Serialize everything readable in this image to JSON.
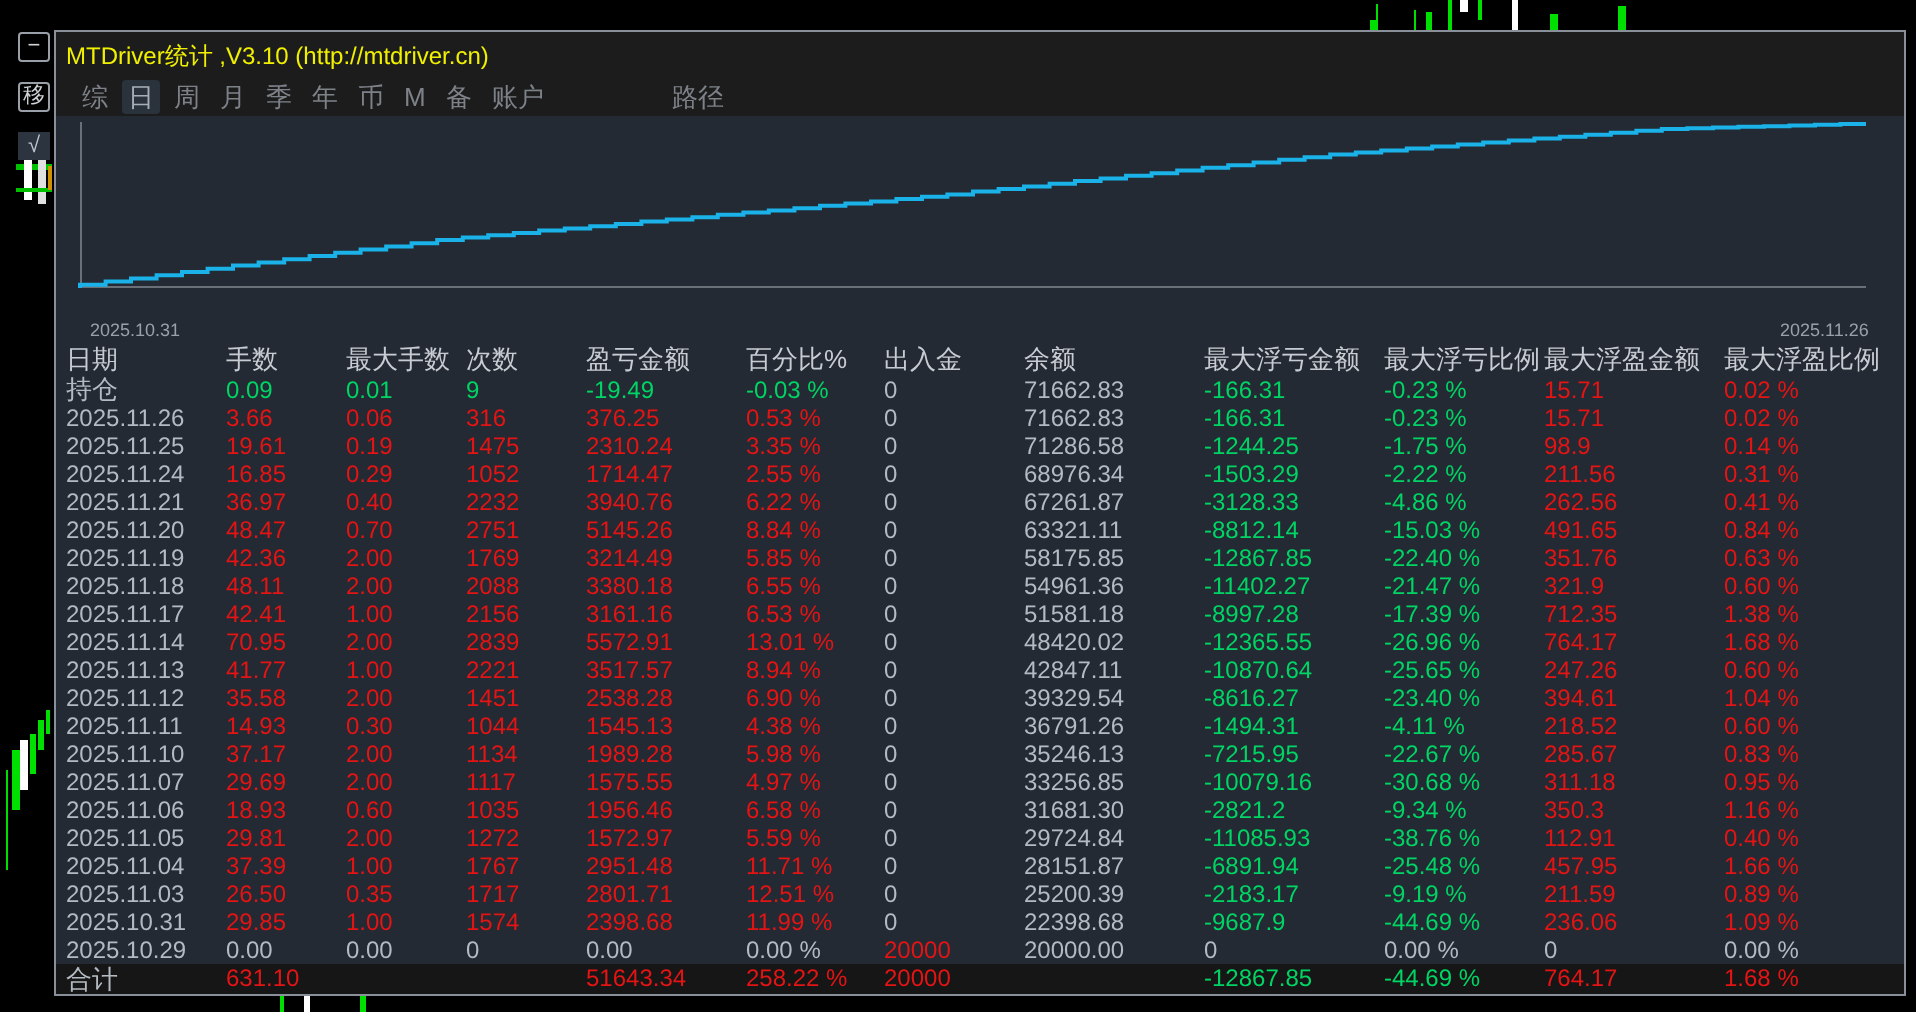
{
  "side_buttons": [
    "−",
    "移",
    "√"
  ],
  "window": {
    "title": "MTDriver统计 ,V3.10 (http://mtdriver.cn)"
  },
  "tabs": [
    {
      "label": "综",
      "selected": false
    },
    {
      "label": "日",
      "selected": true
    },
    {
      "label": "周",
      "selected": false
    },
    {
      "label": "月",
      "selected": false
    },
    {
      "label": "季",
      "selected": false
    },
    {
      "label": "年",
      "selected": false
    },
    {
      "label": "币",
      "selected": false
    },
    {
      "label": "M",
      "selected": false
    },
    {
      "label": "备",
      "selected": false
    },
    {
      "label": "账户",
      "selected": false
    }
  ],
  "path_tab": {
    "label": "路径"
  },
  "equity_chart": {
    "start_label": "2025.10.31",
    "end_label": "2025.11.26"
  },
  "table": {
    "columns": [
      "日期",
      "手数",
      "最大手数",
      "次数",
      "盈亏金额",
      "百分比%",
      "出入金",
      "余额",
      "最大浮亏金额",
      "最大浮亏比例",
      "最大浮盈金额",
      "最大浮盈比例"
    ],
    "rows": [
      {
        "kind": "open",
        "cells": [
          "持仓",
          "0.09",
          "0.01",
          "9",
          "-19.49",
          "-0.03 %",
          "0",
          "71662.83",
          "-166.31",
          "-0.23 %",
          "15.71",
          "0.02 %"
        ]
      },
      {
        "kind": "day",
        "cells": [
          "2025.11.26",
          "3.66",
          "0.06",
          "316",
          "376.25",
          "0.53 %",
          "0",
          "71662.83",
          "-166.31",
          "-0.23 %",
          "15.71",
          "0.02 %"
        ]
      },
      {
        "kind": "day",
        "cells": [
          "2025.11.25",
          "19.61",
          "0.19",
          "1475",
          "2310.24",
          "3.35 %",
          "0",
          "71286.58",
          "-1244.25",
          "-1.75 %",
          "98.9",
          "0.14 %"
        ]
      },
      {
        "kind": "day",
        "cells": [
          "2025.11.24",
          "16.85",
          "0.29",
          "1052",
          "1714.47",
          "2.55 %",
          "0",
          "68976.34",
          "-1503.29",
          "-2.22 %",
          "211.56",
          "0.31 %"
        ]
      },
      {
        "kind": "day",
        "cells": [
          "2025.11.21",
          "36.97",
          "0.40",
          "2232",
          "3940.76",
          "6.22 %",
          "0",
          "67261.87",
          "-3128.33",
          "-4.86 %",
          "262.56",
          "0.41 %"
        ]
      },
      {
        "kind": "day",
        "cells": [
          "2025.11.20",
          "48.47",
          "0.70",
          "2751",
          "5145.26",
          "8.84 %",
          "0",
          "63321.11",
          "-8812.14",
          "-15.03 %",
          "491.65",
          "0.84 %"
        ]
      },
      {
        "kind": "day",
        "cells": [
          "2025.11.19",
          "42.36",
          "2.00",
          "1769",
          "3214.49",
          "5.85 %",
          "0",
          "58175.85",
          "-12867.85",
          "-22.40 %",
          "351.76",
          "0.63 %"
        ]
      },
      {
        "kind": "day",
        "cells": [
          "2025.11.18",
          "48.11",
          "2.00",
          "2088",
          "3380.18",
          "6.55 %",
          "0",
          "54961.36",
          "-11402.27",
          "-21.47 %",
          "321.9",
          "0.60 %"
        ]
      },
      {
        "kind": "day",
        "cells": [
          "2025.11.17",
          "42.41",
          "1.00",
          "2156",
          "3161.16",
          "6.53 %",
          "0",
          "51581.18",
          "-8997.28",
          "-17.39 %",
          "712.35",
          "1.38 %"
        ]
      },
      {
        "kind": "day",
        "cells": [
          "2025.11.14",
          "70.95",
          "2.00",
          "2839",
          "5572.91",
          "13.01 %",
          "0",
          "48420.02",
          "-12365.55",
          "-26.96 %",
          "764.17",
          "1.68 %"
        ]
      },
      {
        "kind": "day",
        "cells": [
          "2025.11.13",
          "41.77",
          "1.00",
          "2221",
          "3517.57",
          "8.94 %",
          "0",
          "42847.11",
          "-10870.64",
          "-25.65 %",
          "247.26",
          "0.60 %"
        ]
      },
      {
        "kind": "day",
        "cells": [
          "2025.11.12",
          "35.58",
          "2.00",
          "1451",
          "2538.28",
          "6.90 %",
          "0",
          "39329.54",
          "-8616.27",
          "-23.40 %",
          "394.61",
          "1.04 %"
        ]
      },
      {
        "kind": "day",
        "cells": [
          "2025.11.11",
          "14.93",
          "0.30",
          "1044",
          "1545.13",
          "4.38 %",
          "0",
          "36791.26",
          "-1494.31",
          "-4.11 %",
          "218.52",
          "0.60 %"
        ]
      },
      {
        "kind": "day",
        "cells": [
          "2025.11.10",
          "37.17",
          "2.00",
          "1134",
          "1989.28",
          "5.98 %",
          "0",
          "35246.13",
          "-7215.95",
          "-22.67 %",
          "285.67",
          "0.83 %"
        ]
      },
      {
        "kind": "day",
        "cells": [
          "2025.11.07",
          "29.69",
          "2.00",
          "1117",
          "1575.55",
          "4.97 %",
          "0",
          "33256.85",
          "-10079.16",
          "-30.68 %",
          "311.18",
          "0.95 %"
        ]
      },
      {
        "kind": "day",
        "cells": [
          "2025.11.06",
          "18.93",
          "0.60",
          "1035",
          "1956.46",
          "6.58 %",
          "0",
          "31681.30",
          "-2821.2",
          "-9.34 %",
          "350.3",
          "1.16 %"
        ]
      },
      {
        "kind": "day",
        "cells": [
          "2025.11.05",
          "29.81",
          "2.00",
          "1272",
          "1572.97",
          "5.59 %",
          "0",
          "29724.84",
          "-11085.93",
          "-38.76 %",
          "112.91",
          "0.40 %"
        ]
      },
      {
        "kind": "day",
        "cells": [
          "2025.11.04",
          "37.39",
          "1.00",
          "1767",
          "2951.48",
          "11.71 %",
          "0",
          "28151.87",
          "-6891.94",
          "-25.48 %",
          "457.95",
          "1.66 %"
        ]
      },
      {
        "kind": "day",
        "cells": [
          "2025.11.03",
          "26.50",
          "0.35",
          "1717",
          "2801.71",
          "12.51 %",
          "0",
          "25200.39",
          "-2183.17",
          "-9.19 %",
          "211.59",
          "0.89 %"
        ]
      },
      {
        "kind": "day",
        "cells": [
          "2025.10.31",
          "29.85",
          "1.00",
          "1574",
          "2398.68",
          "11.99 %",
          "0",
          "22398.68",
          "-9687.9",
          "-44.69 %",
          "236.06",
          "1.09 %"
        ]
      },
      {
        "kind": "deposit",
        "cells": [
          "2025.10.29",
          "0.00",
          "0.00",
          "0",
          "0.00",
          "0.00 %",
          "20000",
          "20000.00",
          "0",
          "0.00 %",
          "0",
          "0.00 %"
        ]
      }
    ],
    "total": {
      "cells": [
        "合计",
        "631.10",
        null,
        null,
        "51643.34",
        "258.22 %",
        "20000",
        null,
        "-12867.85",
        "-44.69 %",
        "764.17",
        "1.68 %"
      ]
    }
  }
}
